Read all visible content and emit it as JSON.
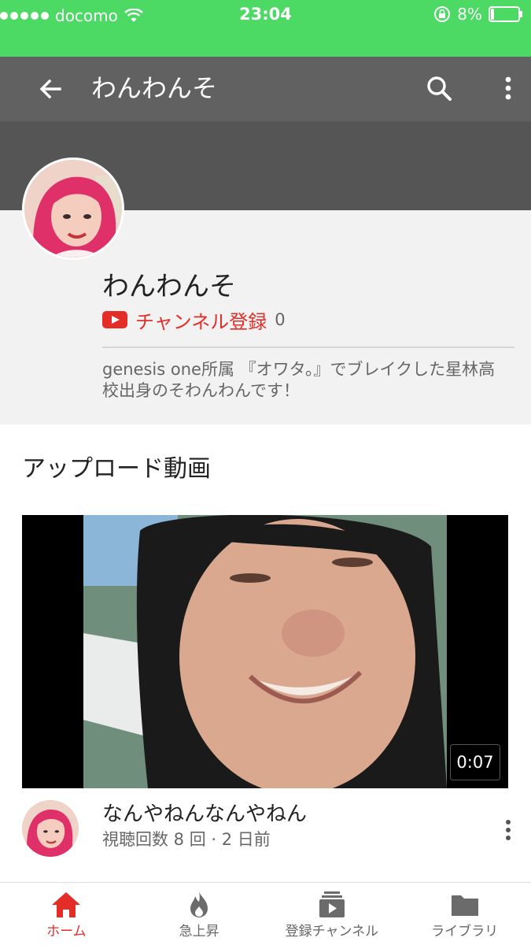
{
  "status_bar": {
    "carrier": "docomo",
    "time": "23:04",
    "battery": "8%"
  },
  "app_bar": {
    "title": "わんわんそ",
    "icons": [
      "back-arrow-icon",
      "search-icon",
      "more-vert-icon"
    ]
  },
  "channel": {
    "name": "わんわんそ",
    "subscribe_label": "チャンネル登録",
    "subscriber_count": "0",
    "description": "genesis one所属 『オワタ。』でブレイクした星林高校出身のそわんわんです！"
  },
  "uploads": {
    "section_title": "アップロード動画",
    "videos": [
      {
        "title": "なんやねんなんやねん",
        "stats": "視聴回数 8 回 · 2 日前",
        "duration": "0:07"
      }
    ]
  },
  "bottom_nav": {
    "items": [
      {
        "label": "ホーム",
        "icon": "home-icon",
        "active": true
      },
      {
        "label": "急上昇",
        "icon": "trending-flame-icon",
        "active": false
      },
      {
        "label": "登録チャンネル",
        "icon": "subscriptions-icon",
        "active": false
      },
      {
        "label": "ライブラリ",
        "icon": "library-folder-icon",
        "active": false
      }
    ]
  },
  "colors": {
    "status_bar": "#4cd964",
    "app_bar": "#616161",
    "banner": "#555555",
    "accent_red": "#e52d27"
  }
}
